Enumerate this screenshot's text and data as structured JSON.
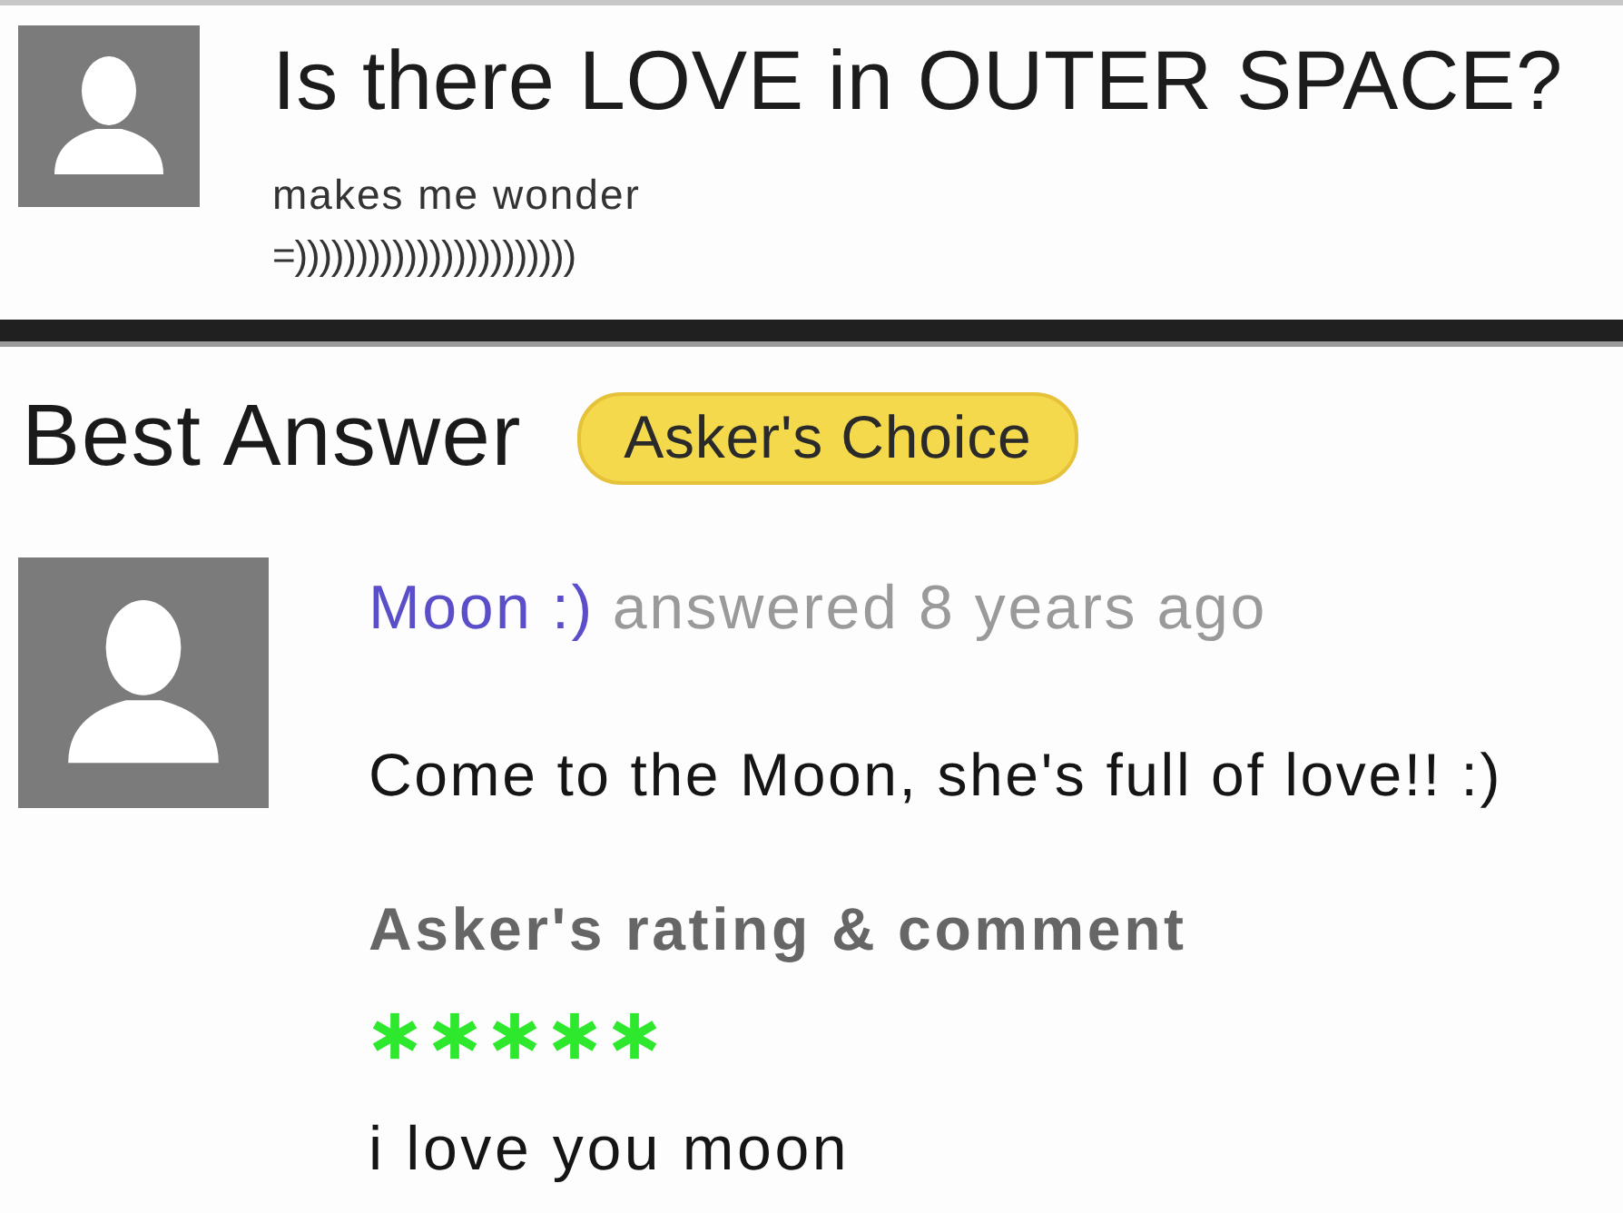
{
  "question": {
    "title": "Is there LOVE in OUTER SPACE?",
    "details": [
      "makes me wonder",
      "=)))))))))))))))))))))))"
    ]
  },
  "best_answer": {
    "heading": "Best Answer",
    "badge": "Asker's Choice",
    "author": "Moon :)",
    "meta": "answered 8 years ago",
    "text": "Come to the Moon, she's full of love!! :)",
    "rating": {
      "heading": "Asker's rating & comment",
      "stars": 5,
      "comment": "i love you moon"
    }
  }
}
